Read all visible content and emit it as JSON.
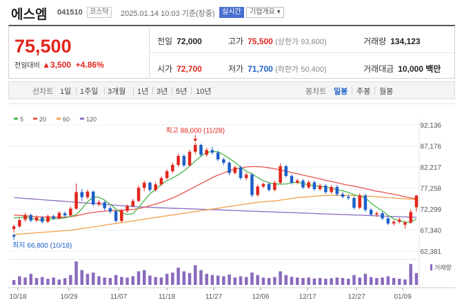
{
  "header": {
    "name": "에스엠",
    "code": "041510",
    "market": "코스닥",
    "time": "2025.01.14 10:03 기준(장중)",
    "realtime_label": "실시간",
    "overview_label": "기업개요 ▾"
  },
  "summary": {
    "price": "75,500",
    "change_label": "전일대비",
    "change_value": "▲3,500",
    "change_rate": "+4.86%",
    "prev_close_label": "전일",
    "prev_close": "72,000",
    "high_label": "고가",
    "high": "75,500",
    "upper_limit": "(상한가 93,600)",
    "volume_label": "거래량",
    "volume": "134,123",
    "open_label": "시가",
    "open": "72,700",
    "low_label": "저가",
    "low": "71,700",
    "lower_limit": "(하한가 50,400)",
    "trade_value_label": "거래대금",
    "trade_value": "10,000 백만"
  },
  "tabs": {
    "line_label": "선차트",
    "line_periods": [
      "1일",
      "1주일",
      "3개월",
      "1년",
      "3년",
      "5년",
      "10년"
    ],
    "candle_label": "봉차트",
    "candle_periods": [
      "일봉",
      "주봉",
      "월봉"
    ],
    "active_candle": "일봉"
  },
  "colors": {
    "up": "#e1261c",
    "down": "#1e5fc8",
    "ma5": "#48b648",
    "ma20": "#e8534a",
    "ma60": "#f0a04b",
    "ma120": "#8a6bbe",
    "volume": "#8a6bbe"
  },
  "chart_data": {
    "type": "candlestick",
    "legend": [
      "5",
      "20",
      "60",
      "120"
    ],
    "y_ticks": [
      "92,136",
      "87,176",
      "82,217",
      "77,258",
      "72,299",
      "67,340",
      "62,381"
    ],
    "ylim": [
      62381,
      92136
    ],
    "x_ticks": [
      "10/18",
      "10/29",
      "11/07",
      "11/18",
      "11/27",
      "12/06",
      "12/17",
      "12/27",
      "01/09"
    ],
    "annotation_high": "최고 88,000 (11/28)",
    "annotation_low": "최저 66,800 (10/18)",
    "volume_label": "거래량",
    "candles": [
      {
        "o": 67600,
        "c": 68200,
        "h": 68600,
        "l": 66800
      },
      {
        "o": 68200,
        "c": 69700,
        "h": 70100,
        "l": 67900
      },
      {
        "o": 69800,
        "c": 70900,
        "h": 71400,
        "l": 69300
      },
      {
        "o": 70900,
        "c": 69600,
        "h": 71200,
        "l": 69200
      },
      {
        "o": 69600,
        "c": 70300,
        "h": 70800,
        "l": 69200
      },
      {
        "o": 70300,
        "c": 69300,
        "h": 70700,
        "l": 68900
      },
      {
        "o": 69300,
        "c": 70600,
        "h": 71000,
        "l": 69000
      },
      {
        "o": 70600,
        "c": 70100,
        "h": 71000,
        "l": 69700
      },
      {
        "o": 70100,
        "c": 71400,
        "h": 71800,
        "l": 69800
      },
      {
        "o": 71300,
        "c": 70800,
        "h": 71700,
        "l": 70400
      },
      {
        "o": 70800,
        "c": 72400,
        "h": 72900,
        "l": 70500
      },
      {
        "o": 72400,
        "c": 76300,
        "h": 78300,
        "l": 72100
      },
      {
        "o": 76300,
        "c": 75100,
        "h": 77000,
        "l": 74200
      },
      {
        "o": 75100,
        "c": 76400,
        "h": 76900,
        "l": 74600
      },
      {
        "o": 76400,
        "c": 73400,
        "h": 76700,
        "l": 73000
      },
      {
        "o": 73400,
        "c": 73900,
        "h": 74400,
        "l": 72900
      },
      {
        "o": 73900,
        "c": 72500,
        "h": 74200,
        "l": 71900
      },
      {
        "o": 72500,
        "c": 71700,
        "h": 73000,
        "l": 71200
      },
      {
        "o": 71800,
        "c": 69500,
        "h": 72100,
        "l": 69100
      },
      {
        "o": 69500,
        "c": 71900,
        "h": 72300,
        "l": 69200
      },
      {
        "o": 71900,
        "c": 73000,
        "h": 73400,
        "l": 71400
      },
      {
        "o": 73000,
        "c": 74200,
        "h": 74700,
        "l": 72700
      },
      {
        "o": 74200,
        "c": 77300,
        "h": 77800,
        "l": 73900
      },
      {
        "o": 77300,
        "c": 78500,
        "h": 79000,
        "l": 76500
      },
      {
        "o": 78500,
        "c": 76800,
        "h": 78800,
        "l": 76400
      },
      {
        "o": 76800,
        "c": 78100,
        "h": 78600,
        "l": 76400
      },
      {
        "o": 78100,
        "c": 79600,
        "h": 80000,
        "l": 77700
      },
      {
        "o": 79600,
        "c": 81200,
        "h": 81700,
        "l": 79300
      },
      {
        "o": 81200,
        "c": 82700,
        "h": 83200,
        "l": 80800
      },
      {
        "o": 82700,
        "c": 84800,
        "h": 85300,
        "l": 82300
      },
      {
        "o": 84800,
        "c": 82600,
        "h": 85200,
        "l": 82200
      },
      {
        "o": 82600,
        "c": 85800,
        "h": 86300,
        "l": 82300
      },
      {
        "o": 85800,
        "c": 87400,
        "h": 88000,
        "l": 85200
      },
      {
        "o": 87400,
        "c": 85100,
        "h": 87700,
        "l": 84600
      },
      {
        "o": 85100,
        "c": 86200,
        "h": 86700,
        "l": 84700
      },
      {
        "o": 86200,
        "c": 85600,
        "h": 87000,
        "l": 85100
      },
      {
        "o": 85600,
        "c": 84000,
        "h": 86000,
        "l": 83600
      },
      {
        "o": 84000,
        "c": 83200,
        "h": 84400,
        "l": 82600
      },
      {
        "o": 83200,
        "c": 80800,
        "h": 83600,
        "l": 80300
      },
      {
        "o": 80800,
        "c": 82100,
        "h": 82600,
        "l": 80400
      },
      {
        "o": 82100,
        "c": 79600,
        "h": 82500,
        "l": 79200
      },
      {
        "o": 79600,
        "c": 80400,
        "h": 80900,
        "l": 79100
      },
      {
        "o": 80400,
        "c": 75600,
        "h": 80800,
        "l": 75100
      },
      {
        "o": 75600,
        "c": 77600,
        "h": 78100,
        "l": 75200
      },
      {
        "o": 77600,
        "c": 78200,
        "h": 78600,
        "l": 77200
      },
      {
        "o": 78200,
        "c": 76800,
        "h": 78600,
        "l": 76400
      },
      {
        "o": 76800,
        "c": 78500,
        "h": 79000,
        "l": 76500
      },
      {
        "o": 78500,
        "c": 82400,
        "h": 83100,
        "l": 78100
      },
      {
        "o": 82400,
        "c": 80100,
        "h": 82700,
        "l": 79700
      },
      {
        "o": 80100,
        "c": 78500,
        "h": 80500,
        "l": 78100
      },
      {
        "o": 78500,
        "c": 79000,
        "h": 79500,
        "l": 78100
      },
      {
        "o": 79000,
        "c": 77400,
        "h": 79400,
        "l": 77000
      },
      {
        "o": 77400,
        "c": 78600,
        "h": 79100,
        "l": 77000
      },
      {
        "o": 78600,
        "c": 77000,
        "h": 79000,
        "l": 76600
      },
      {
        "o": 77000,
        "c": 77800,
        "h": 78300,
        "l": 76600
      },
      {
        "o": 77800,
        "c": 76300,
        "h": 78200,
        "l": 75900
      },
      {
        "o": 76300,
        "c": 77500,
        "h": 77900,
        "l": 75900
      },
      {
        "o": 77500,
        "c": 75800,
        "h": 78000,
        "l": 75400
      },
      {
        "o": 75800,
        "c": 75200,
        "h": 76300,
        "l": 74800
      },
      {
        "o": 75200,
        "c": 74900,
        "h": 75700,
        "l": 74400
      },
      {
        "o": 74900,
        "c": 72600,
        "h": 75300,
        "l": 72200
      },
      {
        "o": 72600,
        "c": 75500,
        "h": 76000,
        "l": 72300
      },
      {
        "o": 75500,
        "c": 72100,
        "h": 75900,
        "l": 71600
      },
      {
        "o": 72100,
        "c": 71000,
        "h": 72500,
        "l": 70600
      },
      {
        "o": 71000,
        "c": 71300,
        "h": 71700,
        "l": 70500
      },
      {
        "o": 71300,
        "c": 70100,
        "h": 71700,
        "l": 69700
      },
      {
        "o": 70100,
        "c": 68900,
        "h": 70500,
        "l": 68500
      },
      {
        "o": 68900,
        "c": 69300,
        "h": 69700,
        "l": 68400
      },
      {
        "o": 69300,
        "c": 69800,
        "h": 70300,
        "l": 68900
      },
      {
        "o": 68600,
        "c": 69100,
        "h": 69500,
        "l": 67700
      },
      {
        "o": 69100,
        "c": 71600,
        "h": 72200,
        "l": 68800
      },
      {
        "o": 72700,
        "c": 75500,
        "h": 75500,
        "l": 71700
      }
    ],
    "ma5": [
      70200,
      70300,
      70400,
      70100,
      69900,
      69600,
      69900,
      70000,
      70100,
      70200,
      70500,
      71000,
      72400,
      74000,
      75100,
      75100,
      74400,
      73400,
      72300,
      71400,
      71000,
      71200,
      72700,
      74300,
      75900,
      76900,
      78100,
      79000,
      79600,
      80400,
      81300,
      82400,
      83600,
      84800,
      85600,
      85900,
      85800,
      85100,
      84200,
      83300,
      82200,
      81200,
      80600,
      79700,
      79000,
      78500,
      78200,
      78200,
      78200,
      78500,
      78600,
      78300,
      78000,
      77800,
      77700,
      77500,
      77200,
      76800,
      76600,
      76200,
      75700,
      75300,
      74900,
      73700,
      72700,
      71900,
      70800,
      70000,
      69500,
      69200,
      69200,
      70000
    ],
    "ma20": [
      70900,
      70800,
      70700,
      70600,
      70500,
      70400,
      70400,
      70400,
      70400,
      70400,
      70500,
      70700,
      71000,
      71300,
      71500,
      71700,
      71800,
      71900,
      72000,
      72000,
      72100,
      72200,
      72400,
      72700,
      73100,
      73500,
      73900,
      74400,
      74900,
      75500,
      76200,
      76900,
      77600,
      78300,
      79000,
      79700,
      80300,
      80800,
      81300,
      81700,
      82000,
      82200,
      82300,
      82300,
      82200,
      82000,
      81800,
      81500,
      81200,
      80900,
      80600,
      80300,
      80000,
      79700,
      79400,
      79100,
      78800,
      78500,
      78200,
      77900,
      77700,
      77400,
      77100,
      76800,
      76500,
      76300,
      76000,
      75800,
      75500,
      75200,
      74900,
      74700
    ],
    "ma60": [
      66300,
      66400,
      66500,
      66600,
      66700,
      66800,
      66900,
      67000,
      67100,
      67200,
      67300,
      67500,
      67700,
      67900,
      68100,
      68300,
      68500,
      68700,
      68900,
      69100,
      69300,
      69500,
      69700,
      69900,
      70100,
      70300,
      70500,
      70700,
      70900,
      71100,
      71300,
      71500,
      71700,
      71900,
      72100,
      72300,
      72500,
      72700,
      72900,
      73100,
      73300,
      73500,
      73700,
      73900,
      74000,
      74100,
      74200,
      74400,
      74600,
      74800,
      75000,
      75100,
      75200,
      75300,
      75400,
      75500,
      75500,
      75500,
      75500,
      75500,
      75500,
      75400,
      75400,
      75300,
      75200,
      75100,
      75000,
      74900,
      74800,
      74700,
      74600,
      74500
    ],
    "ma120": [
      75000,
      74900,
      74800,
      74700,
      74600,
      74500,
      74400,
      74300,
      74200,
      74100,
      74000,
      73900,
      73800,
      73700,
      73600,
      73500,
      73400,
      73300,
      73200,
      73100,
      73000,
      72900,
      72800,
      72750,
      72700,
      72650,
      72600,
      72550,
      72500,
      72450,
      72400,
      72350,
      72300,
      72250,
      72200,
      72150,
      72100,
      72050,
      72000,
      71950,
      71900,
      71850,
      71800,
      71750,
      71700,
      71650,
      71600,
      71550,
      71500,
      71450,
      71400,
      71350,
      71300,
      71250,
      71200,
      71150,
      71100,
      71050,
      71000,
      70950,
      70900,
      70850,
      70800,
      70750,
      70700,
      70650,
      70600,
      70550,
      70500,
      70450,
      70400,
      70350
    ],
    "volume": [
      20,
      35,
      30,
      45,
      28,
      32,
      25,
      30,
      22,
      27,
      40,
      95,
      60,
      45,
      50,
      35,
      30,
      28,
      40,
      32,
      30,
      35,
      55,
      60,
      38,
      32,
      30,
      45,
      50,
      70,
      55,
      48,
      80,
      60,
      45,
      40,
      38,
      35,
      42,
      30,
      35,
      32,
      50,
      40,
      30,
      28,
      32,
      55,
      40,
      33,
      30,
      28,
      30,
      26,
      28,
      25,
      27,
      30,
      28,
      25,
      40,
      30,
      45,
      32,
      28,
      30,
      35,
      28,
      25,
      22,
      85,
      48
    ]
  }
}
